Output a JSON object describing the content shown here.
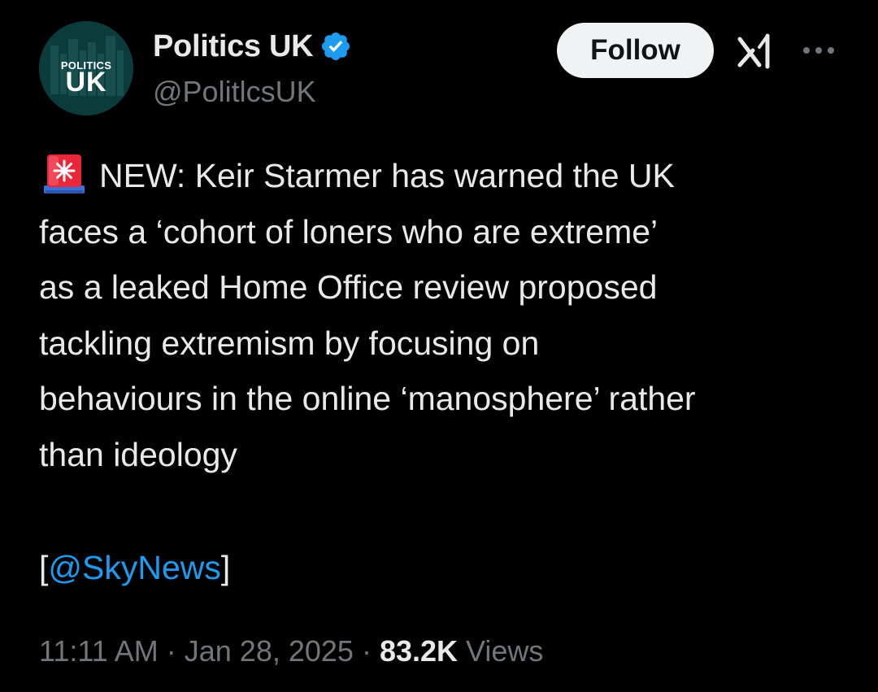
{
  "author": {
    "avatar_text_top": "POLITICS",
    "avatar_text_bottom": "UK",
    "display_name": "Politics UK",
    "handle": "@PolitlcsUK",
    "verified_icon": "verified-badge-icon"
  },
  "actions": {
    "follow_label": "Follow",
    "grok_icon": "grok-icon",
    "more_icon": "more-horizontal-icon"
  },
  "tweet": {
    "emoji": "rotating-light-siren-icon",
    "lines": [
      "NEW: Keir Starmer has warned the UK",
      "faces a ‘cohort of loners who are extreme’",
      "as a leaked Home Office review proposed",
      "tackling extremism by focusing on",
      "behaviours in the online ‘manosphere’ rather",
      "than ideology"
    ],
    "source_open": "[",
    "source_mention": "@SkyNews",
    "source_close": "]"
  },
  "meta": {
    "time": "11:11 AM",
    "separator": " · ",
    "date": "Jan 28, 2025",
    "views_count": "83.2K",
    "views_label": " Views"
  },
  "colors": {
    "background": "#000000",
    "text_primary": "#e7e9ea",
    "text_secondary": "#71767b",
    "link": "#1d9bf0",
    "verified": "#1d9bf0",
    "avatar": "#0c3b3b"
  }
}
